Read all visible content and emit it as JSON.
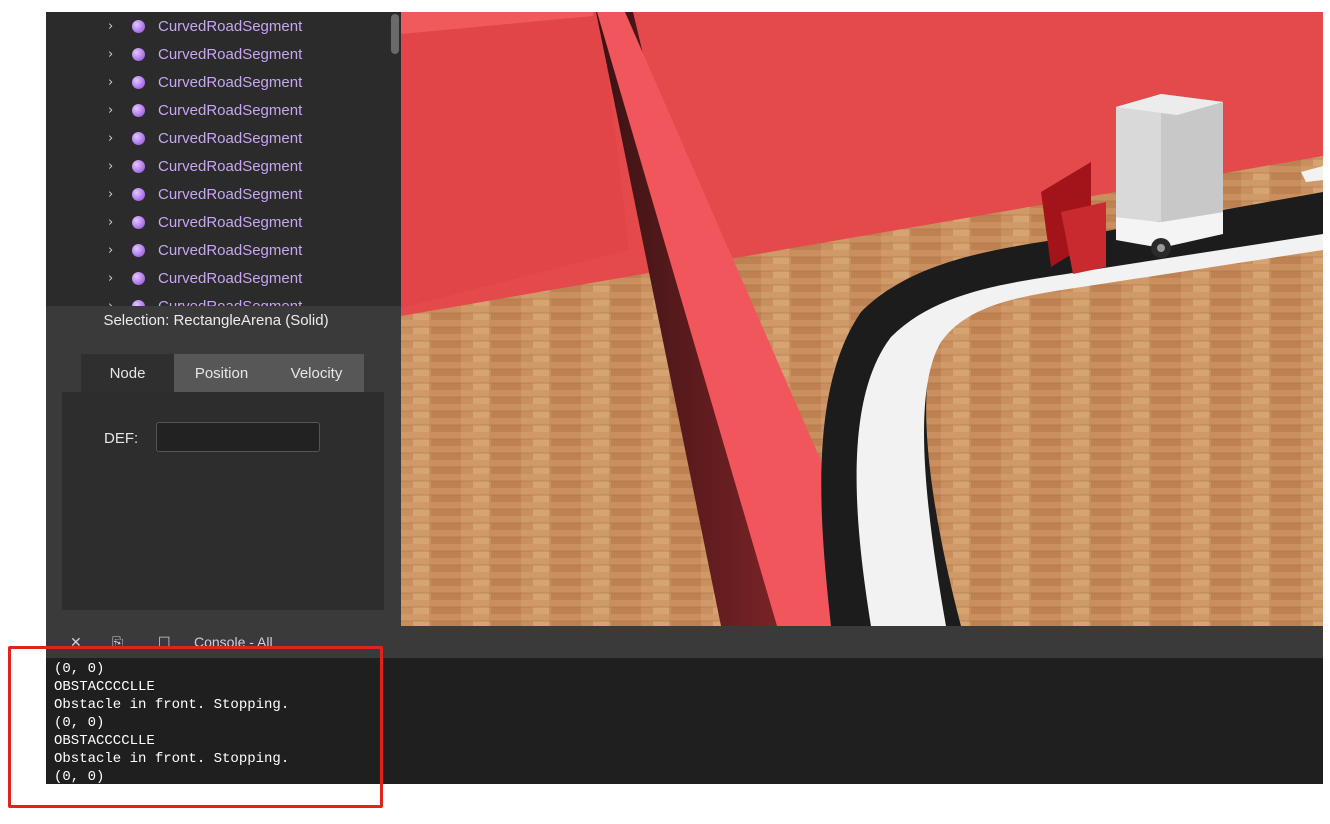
{
  "scene_tree": {
    "items": [
      {
        "label": "CurvedRoadSegment"
      },
      {
        "label": "CurvedRoadSegment"
      },
      {
        "label": "CurvedRoadSegment"
      },
      {
        "label": "CurvedRoadSegment"
      },
      {
        "label": "CurvedRoadSegment"
      },
      {
        "label": "CurvedRoadSegment"
      },
      {
        "label": "CurvedRoadSegment"
      },
      {
        "label": "CurvedRoadSegment"
      },
      {
        "label": "CurvedRoadSegment"
      },
      {
        "label": "CurvedRoadSegment"
      },
      {
        "label": "CurvedRoadSegment"
      }
    ],
    "chevron_icon": "chevron-right-icon",
    "node_icon": "purple-sphere-icon"
  },
  "selection_panel": {
    "title": "Selection: RectangleArena (Solid)",
    "tabs": [
      {
        "label": "Node",
        "active": true
      },
      {
        "label": "Position",
        "active": false
      },
      {
        "label": "Velocity",
        "active": false
      }
    ],
    "def_label": "DEF:",
    "def_value": ""
  },
  "console_bar": {
    "close_icon": "close-icon",
    "clear_icon": "clear-icon",
    "window_icon": "window-icon",
    "title": "Console - All"
  },
  "console": {
    "lines": [
      "(0, 0)",
      "OBSTACCCCLLE",
      "Obstacle in front. Stopping.",
      "(0, 0)",
      "OBSTACCCCLLE",
      "Obstacle in front. Stopping.",
      "(0, 0)"
    ]
  },
  "colors": {
    "highlight": "#e0231c",
    "tree_label": "#c7a6f2",
    "wall_red": "#e44a4c"
  }
}
